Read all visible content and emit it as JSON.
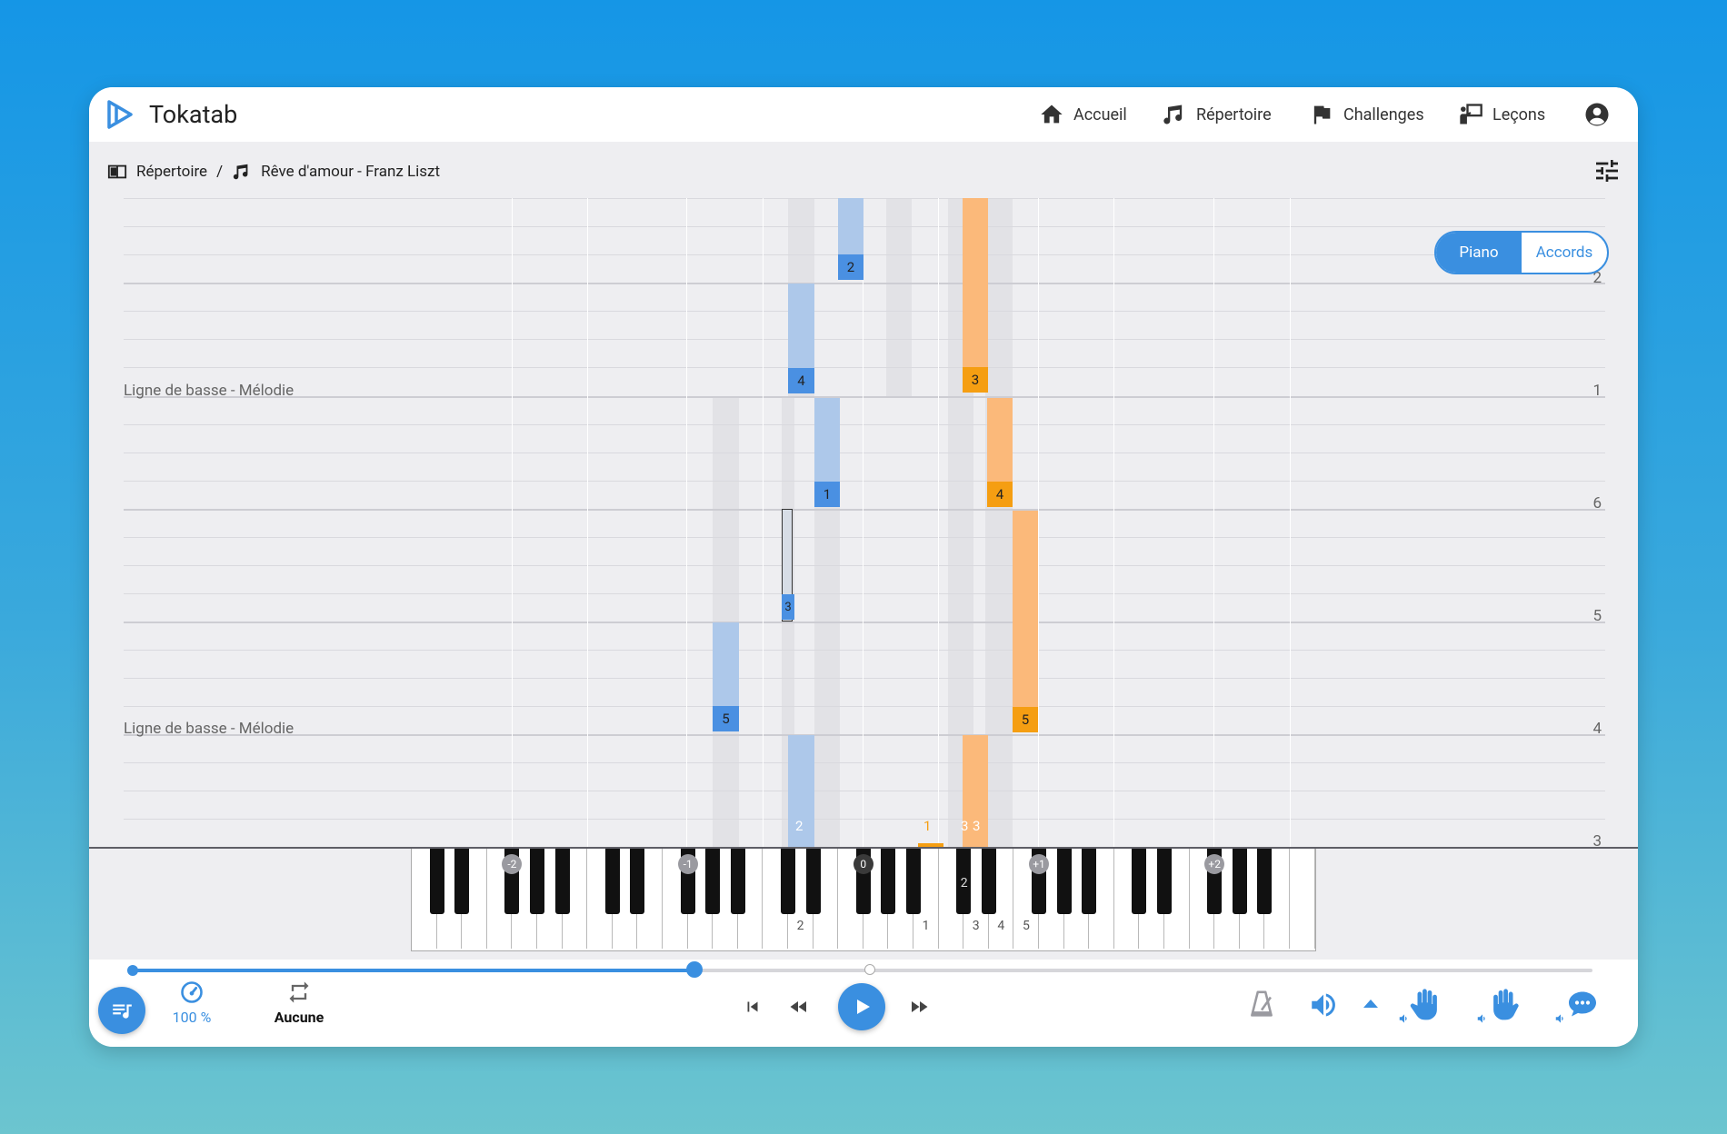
{
  "app": {
    "title": "Tokatab"
  },
  "nav": {
    "items": [
      {
        "label": "Accueil",
        "icon": "home-icon"
      },
      {
        "label": "Répertoire",
        "icon": "music-note-icon"
      },
      {
        "label": "Challenges",
        "icon": "flag-icon"
      },
      {
        "label": "Leçons",
        "icon": "teacher-board-icon"
      }
    ],
    "account_icon": "account-circle-icon"
  },
  "breadcrumb": {
    "root": "Répertoire",
    "separator": "/",
    "current": "Rêve d'amour - Franz Liszt"
  },
  "mode_toggle": {
    "active": "Piano",
    "inactive": "Accords"
  },
  "roll": {
    "section_labels": [
      "Ligne de basse - Mélodie",
      "Ligne de basse - Mélodie"
    ],
    "measure_numbers": [
      "2",
      "1",
      "6",
      "5",
      "4",
      "3"
    ],
    "finger_labels": [
      "2",
      "4",
      "3",
      "1",
      "4",
      "3",
      "5",
      "5",
      "2",
      "1",
      "2",
      "3"
    ]
  },
  "keyboard": {
    "octave_markers": [
      "-2",
      "-1",
      "0",
      "+1",
      "+2"
    ],
    "key_fingerings": [
      "2",
      "1",
      "3",
      "4",
      "5",
      "2"
    ]
  },
  "player": {
    "progress": 0.385,
    "marker": 0.505,
    "speed": "100 %",
    "loop": "Aucune"
  },
  "colors": {
    "accent": "#3a8fe0",
    "left_hand": "#4a90e2",
    "right_hand": "#f59e12"
  }
}
